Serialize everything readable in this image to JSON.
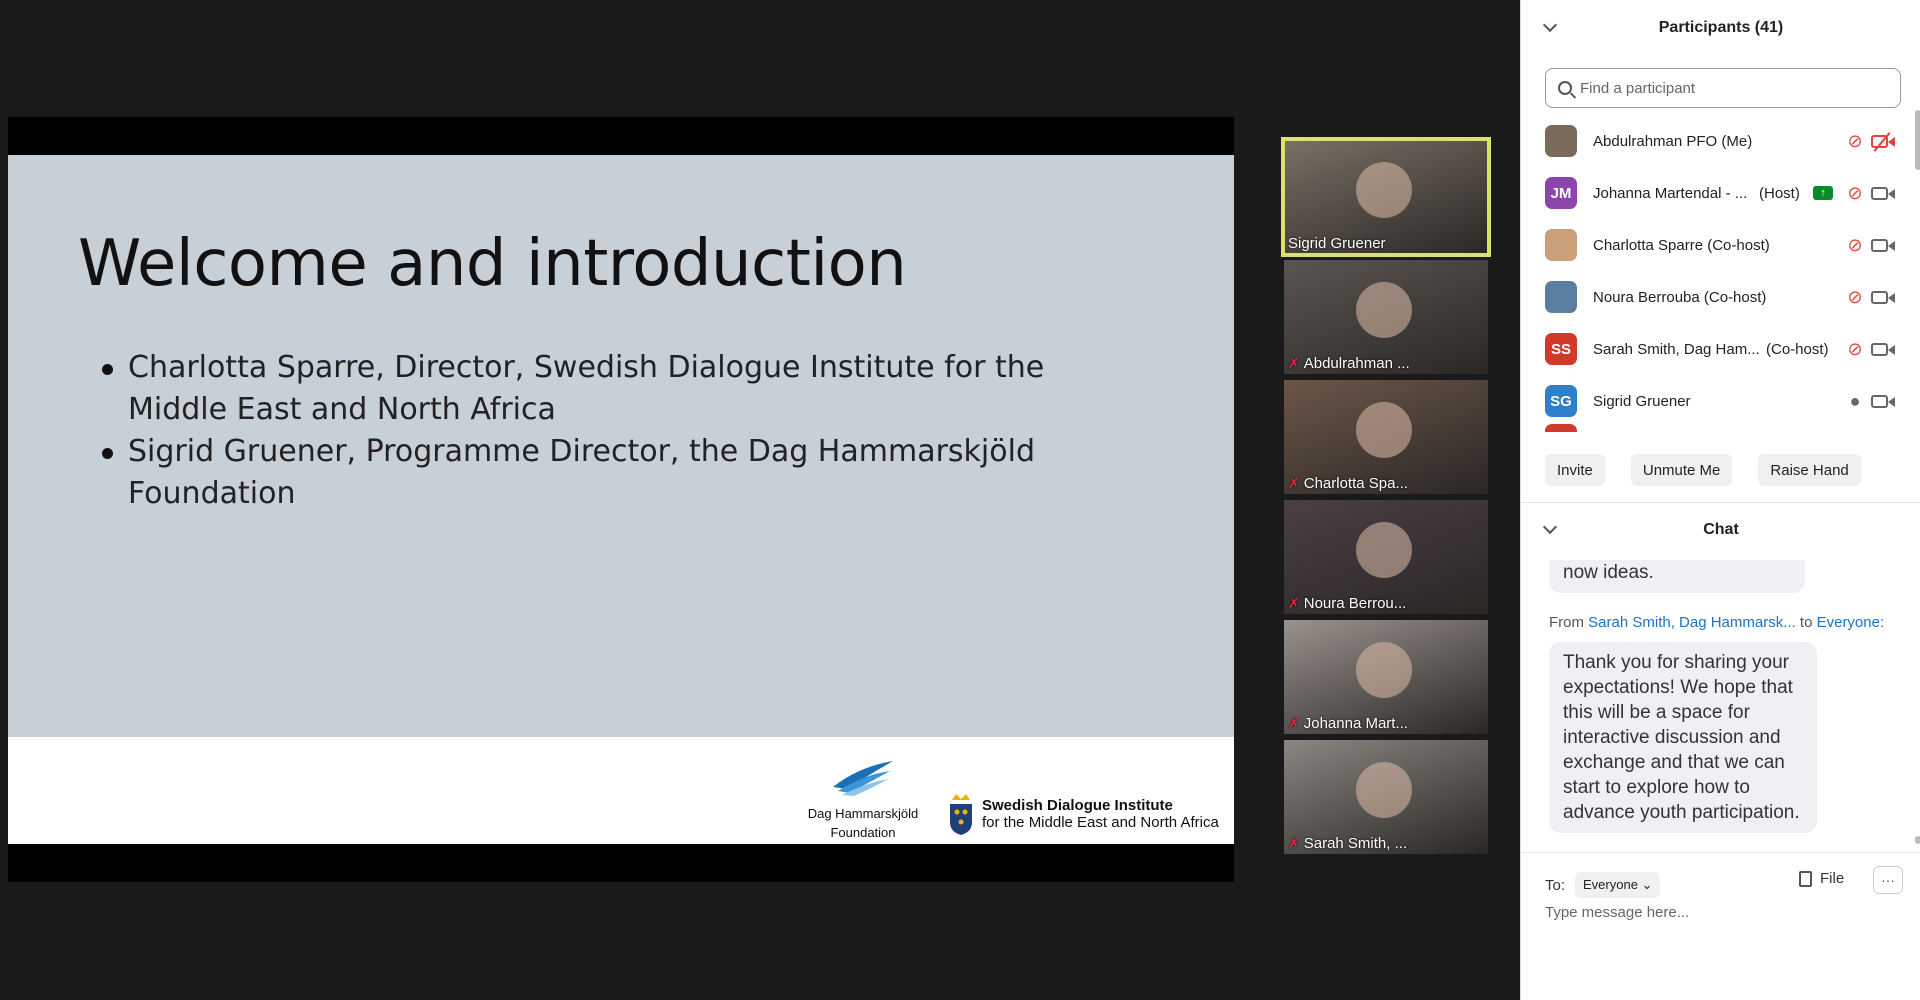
{
  "slide": {
    "title": "Welcome and introduction",
    "bullets": [
      "Charlotta Sparre, Director, Swedish Dialogue Institute for the Middle East and North Africa",
      "Sigrid Gruener, Programme Director, the Dag Hammarskjöld Foundation"
    ],
    "logo_dh_line1": "Dag Hammarskjöld",
    "logo_dh_line2": "Foundation",
    "logo_sdi_line1": "Swedish Dialogue Institute",
    "logo_sdi_line2": "for the Middle East and North Africa"
  },
  "gallery": [
    {
      "name": "Sigrid Gruener",
      "muted": false,
      "active": true,
      "color": "#7a7065"
    },
    {
      "name": "Abdulrahman ...",
      "muted": true,
      "active": false,
      "color": "#5a5550"
    },
    {
      "name": "Charlotta Spa...",
      "muted": true,
      "active": false,
      "color": "#6b5648"
    },
    {
      "name": "Noura Berrou...",
      "muted": true,
      "active": false,
      "color": "#4a3f45"
    },
    {
      "name": "Johanna Mart...",
      "muted": true,
      "active": false,
      "color": "#9a928c"
    },
    {
      "name": "Sarah Smith, ...",
      "muted": true,
      "active": false,
      "color": "#8a8680"
    }
  ],
  "participants": {
    "title": "Participants (41)",
    "search_placeholder": "Find a participant",
    "list": [
      {
        "name": "Abdulrahman PFO (Me)",
        "role": "",
        "initials": "",
        "avatar_color": "#7a6a5a",
        "photo": true,
        "mic": "off",
        "cam": "off",
        "sharing": false
      },
      {
        "name": "Johanna Martendal - ...",
        "role": "(Host)",
        "initials": "JM",
        "avatar_color": "#8e44ad",
        "photo": false,
        "mic": "off",
        "cam": "on",
        "sharing": true
      },
      {
        "name": "Charlotta Sparre (Co-host)",
        "role": "",
        "initials": "",
        "avatar_color": "#c9a07a",
        "photo": true,
        "mic": "off",
        "cam": "on",
        "sharing": false
      },
      {
        "name": "Noura Berrouba (Co-host)",
        "role": "",
        "initials": "",
        "avatar_color": "#5a7fa0",
        "photo": true,
        "mic": "off",
        "cam": "on",
        "sharing": false
      },
      {
        "name": "Sarah Smith, Dag Ham...",
        "role": "(Co-host)",
        "initials": "SS",
        "avatar_color": "#d1392b",
        "photo": false,
        "mic": "off",
        "cam": "on",
        "sharing": false
      },
      {
        "name": "Sigrid Gruener",
        "role": "",
        "initials": "SG",
        "avatar_color": "#2f80c8",
        "photo": false,
        "mic": "on",
        "cam": "on",
        "sharing": false
      }
    ],
    "buttons": {
      "invite": "Invite",
      "unmute": "Unmute Me",
      "raise": "Raise Hand"
    }
  },
  "chat": {
    "title": "Chat",
    "prev_tail": "now ideas.",
    "from_label": "From",
    "from_sender": "Sarah Smith, Dag Hammarsk...",
    "to_label": "to",
    "to_target": "Everyone:",
    "message": "Thank you for sharing your expectations! We hope that this will be a space for interactive discussion and exchange and that we can start to explore how to advance youth participation.",
    "compose_to_label": "To:",
    "compose_to_value": "Everyone",
    "file_label": "File",
    "more_label": "···",
    "input_placeholder": "Type message here..."
  }
}
